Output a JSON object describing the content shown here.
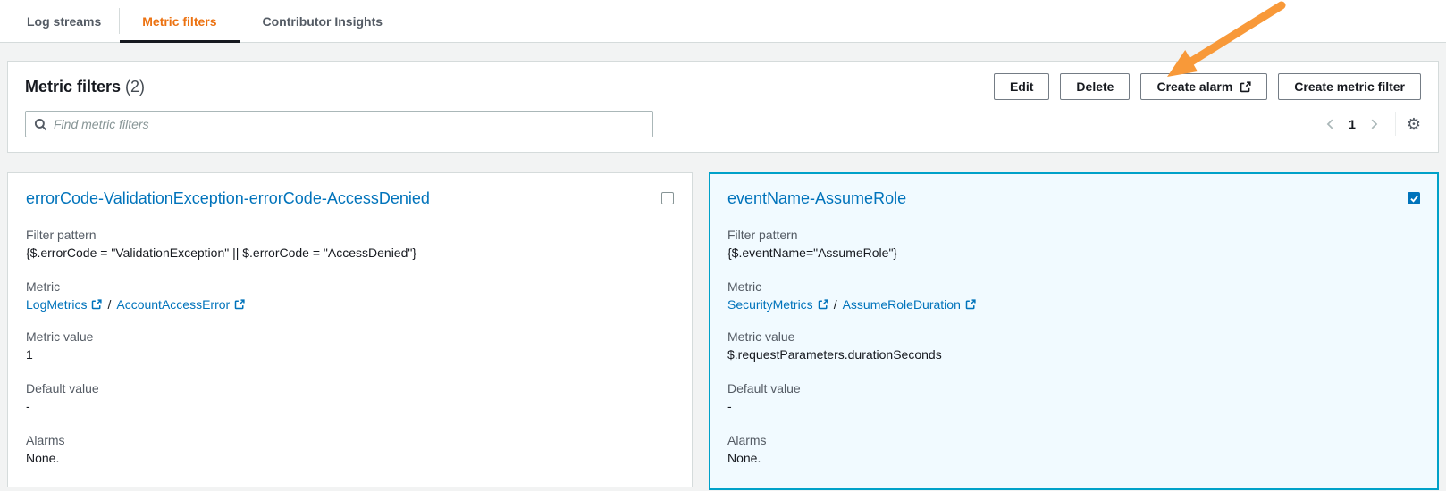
{
  "tabs": [
    {
      "label": "Log streams",
      "active": false
    },
    {
      "label": "Metric filters",
      "active": true
    },
    {
      "label": "Contributor Insights",
      "active": false
    }
  ],
  "header": {
    "title": "Metric filters",
    "count": "(2)",
    "buttons": {
      "edit": "Edit",
      "delete": "Delete",
      "create_alarm": "Create alarm",
      "create_metric_filter": "Create metric filter"
    },
    "search_placeholder": "Find metric filters",
    "pagination": {
      "page": "1"
    }
  },
  "cards": [
    {
      "title": "errorCode-ValidationException-errorCode-AccessDenied",
      "selected": false,
      "labels": {
        "filter_pattern": "Filter pattern",
        "metric": "Metric",
        "metric_value": "Metric value",
        "default_value": "Default value",
        "alarms": "Alarms"
      },
      "filter_pattern": "{$.errorCode = \"ValidationException\" || $.errorCode = \"AccessDenied\"}",
      "metric_namespace": "LogMetrics",
      "metric_separator": "/",
      "metric_name": "AccountAccessError",
      "metric_value": "1",
      "default_value": "-",
      "alarms": "None."
    },
    {
      "title": "eventName-AssumeRole",
      "selected": true,
      "labels": {
        "filter_pattern": "Filter pattern",
        "metric": "Metric",
        "metric_value": "Metric value",
        "default_value": "Default value",
        "alarms": "Alarms"
      },
      "filter_pattern": "{$.eventName=\"AssumeRole\"}",
      "metric_namespace": "SecurityMetrics",
      "metric_separator": "/",
      "metric_name": "AssumeRoleDuration",
      "metric_value": "$.requestParameters.durationSeconds",
      "default_value": "-",
      "alarms": "None."
    }
  ],
  "icons": {
    "gear": "⚙",
    "search": "magnifier",
    "external_link": "box-with-arrow",
    "chevron_left": "‹",
    "chevron_right": "›",
    "checkbox_checked": "✓",
    "annotation_arrow": "orange-arrow-pointing-to-create-alarm"
  },
  "colors": {
    "active_tab_orange": "#ec7211",
    "link_blue": "#0073bb",
    "selected_card_border": "#00a1c9",
    "selected_card_bg": "#f1faff",
    "annotation_arrow_orange": "#f89939",
    "page_bg": "#f2f3f3"
  }
}
